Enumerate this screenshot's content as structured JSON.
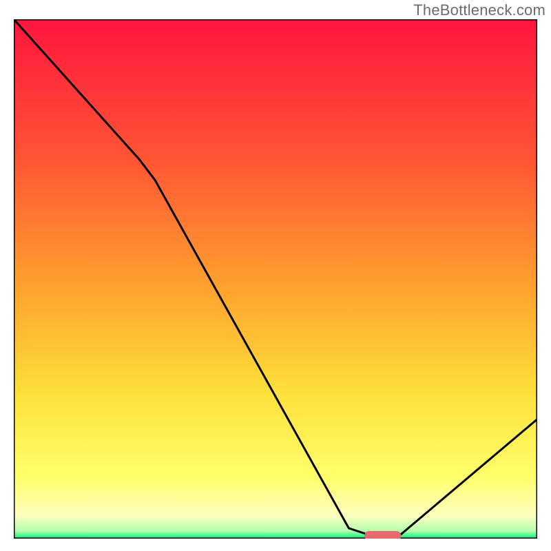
{
  "watermark": "TheBottleneck.com",
  "chart_data": {
    "type": "line",
    "title": "",
    "xlabel": "",
    "ylabel": "",
    "xlim": [
      0,
      100
    ],
    "ylim": [
      0,
      100
    ],
    "grid": false,
    "legend": false,
    "background_gradient_stops": [
      {
        "pct": 0,
        "color": "#ff163e"
      },
      {
        "pct": 0.27,
        "color": "#ff5534"
      },
      {
        "pct": 0.52,
        "color": "#ffa32e"
      },
      {
        "pct": 0.72,
        "color": "#fde03a"
      },
      {
        "pct": 0.88,
        "color": "#ffff6a"
      },
      {
        "pct": 0.955,
        "color": "#ffffbe"
      },
      {
        "pct": 0.985,
        "color": "#b6ffae"
      },
      {
        "pct": 1.0,
        "color": "#00f07a"
      }
    ],
    "series": [
      {
        "name": "bottleneck_curve",
        "x": [
          0,
          24,
          27,
          64,
          70,
          73,
          100
        ],
        "values": [
          100,
          73,
          69,
          2,
          0,
          0,
          23
        ]
      }
    ],
    "annotations": {
      "marker": {
        "x_start": 67,
        "x_end": 74,
        "y": 0,
        "color": "#e46a6d",
        "shape": "capsule"
      }
    }
  }
}
